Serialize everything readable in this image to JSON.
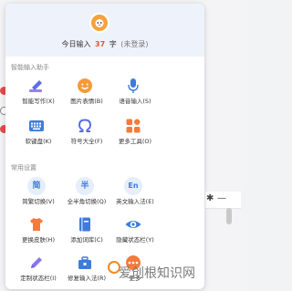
{
  "header": {
    "stats_prefix": "今日输入",
    "count": "37",
    "unit": "字",
    "login_status": "(未登录)"
  },
  "sections": {
    "smart": {
      "title": "智能输入助手",
      "items": [
        {
          "label": "智能写作(X)",
          "icon": "smart-writing-icon"
        },
        {
          "label": "图片表情(B)",
          "icon": "emoji-icon"
        },
        {
          "label": "语音输入(S)",
          "icon": "microphone-icon"
        },
        {
          "label": "软键盘(K)",
          "icon": "keyboard-icon"
        },
        {
          "label": "符号大全(F)",
          "icon": "omega-icon"
        },
        {
          "label": "更多工具(O)",
          "icon": "grid-icon"
        }
      ]
    },
    "common": {
      "title": "常用设置",
      "items": [
        {
          "label": "简繁切换(V)",
          "icon_text": "简"
        },
        {
          "label": "全半角切换(Q)",
          "icon_text": "半"
        },
        {
          "label": "英文输入法(E)",
          "icon_text": "En"
        },
        {
          "label": "更换皮肤(H)",
          "icon": "skin-icon"
        },
        {
          "label": "添加词库(C)",
          "icon": "dictionary-icon"
        },
        {
          "label": "隐藏状态栏(Y)",
          "icon": "eye-icon"
        },
        {
          "label": "定制状态栏(I)",
          "icon": "pen-icon"
        },
        {
          "label": "修复输入法(R)",
          "icon": "toolbox-icon"
        },
        {
          "label": "更多",
          "icon": "more-icon"
        }
      ]
    }
  },
  "watermark": "爱创根知识网",
  "colors": {
    "accent_blue": "#3f7bdc",
    "count_orange": "#e8552d",
    "avatar_orange": "#f6a23a"
  }
}
